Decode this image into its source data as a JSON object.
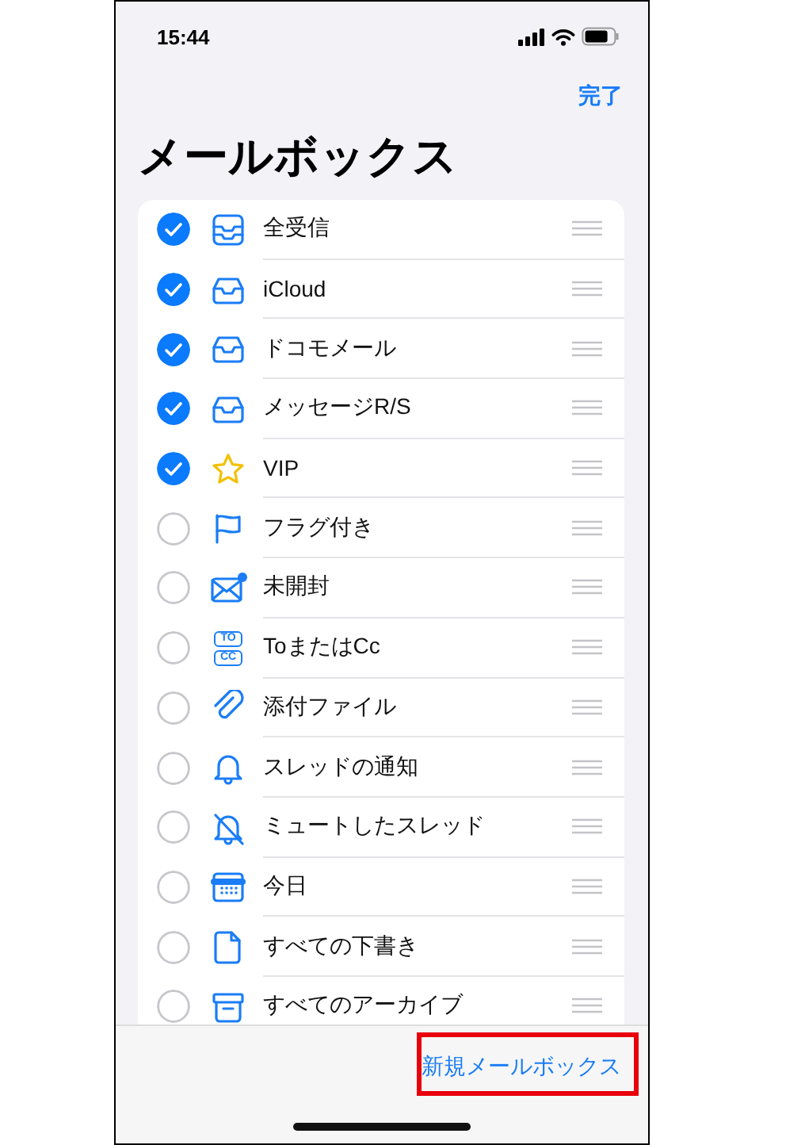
{
  "status_bar": {
    "time": "15:44"
  },
  "nav": {
    "done": "完了"
  },
  "title": "メールボックス",
  "mailboxes": [
    {
      "label": "全受信",
      "checked": true
    },
    {
      "label": "iCloud",
      "checked": true
    },
    {
      "label": "ドコモメール",
      "checked": true
    },
    {
      "label": "メッセージR/S",
      "checked": true
    },
    {
      "label": "VIP",
      "checked": true
    },
    {
      "label": "フラグ付き",
      "checked": false
    },
    {
      "label": "未開封",
      "checked": false
    },
    {
      "label": "ToまたはCc",
      "checked": false,
      "tags": [
        "TO",
        "CC"
      ]
    },
    {
      "label": "添付ファイル",
      "checked": false
    },
    {
      "label": "スレッドの通知",
      "checked": false
    },
    {
      "label": "ミュートしたスレッド",
      "checked": false
    },
    {
      "label": "今日",
      "checked": false
    },
    {
      "label": "すべての下書き",
      "checked": false
    },
    {
      "label": "すべてのアーカイブ",
      "checked": false
    }
  ],
  "toolbar": {
    "new_mailbox": "新規メールボックス",
    "highlighted": true
  }
}
